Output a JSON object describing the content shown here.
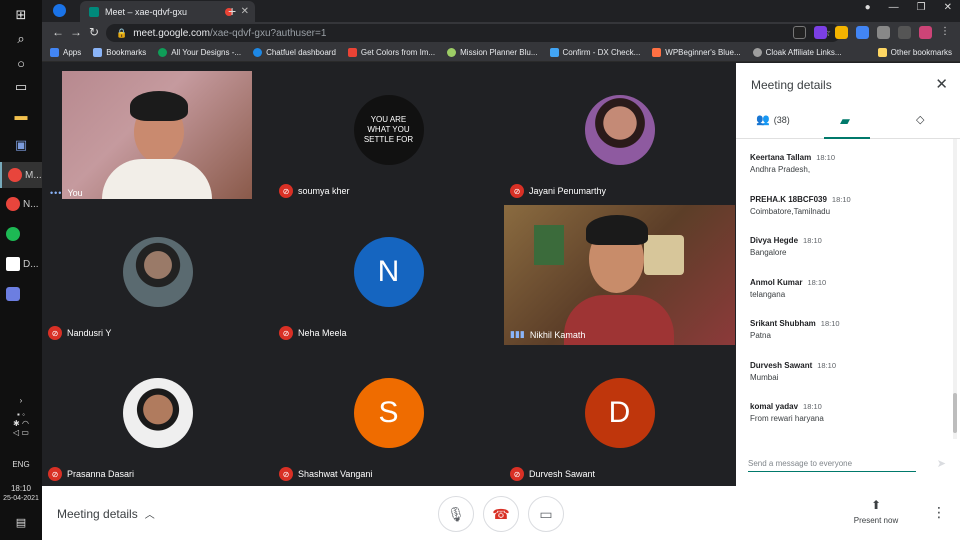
{
  "browser": {
    "tab_title": "Meet – xae-qdvf-gxu",
    "url_host": "meet.google.com",
    "url_path": "/xae-qdvf-gxu?authuser=1",
    "bookmarks": [
      "Apps",
      "Bookmarks",
      "All Your Designs -...",
      "Chatfuel dashboard",
      "Get Colors from Im...",
      "Mission Planner Blu...",
      "Confirm - DX Check...",
      "WPBeginner's Blue...",
      "Cloak Affiliate Links..."
    ],
    "other_bookmarks": "Other bookmarks"
  },
  "taskbar": {
    "apps": [
      "M...",
      "N...",
      "",
      "D...",
      ""
    ],
    "time": "18:10",
    "date": "25-04-2021",
    "lang": "ENG"
  },
  "participants": [
    {
      "name": "You",
      "type": "video-you",
      "muted": false
    },
    {
      "name": "soumya kher",
      "type": "quote",
      "muted": true,
      "quote": "YOU ARE WHAT YOU SETTLE FOR"
    },
    {
      "name": "Jayani Penumarthy",
      "type": "photo",
      "muted": true,
      "color": "#8e5aa0"
    },
    {
      "name": "Nandusri Y",
      "type": "photo",
      "muted": true,
      "color": "#6b6b6b"
    },
    {
      "name": "Neha Meela",
      "type": "letter",
      "muted": true,
      "letter": "N",
      "color": "#1565c0"
    },
    {
      "name": "Nikhil Kamath",
      "type": "video-nik",
      "muted": false
    },
    {
      "name": "Prasanna Dasari",
      "type": "photo",
      "muted": true,
      "color": "#efefef"
    },
    {
      "name": "Shashwat Vangani",
      "type": "letter",
      "muted": true,
      "letter": "S",
      "color": "#ef6c00"
    },
    {
      "name": "Durvesh Sawant",
      "type": "letter",
      "muted": true,
      "letter": "D",
      "color": "#bf360c"
    }
  ],
  "panel": {
    "title": "Meeting details",
    "people_count": "(38)",
    "messages": [
      {
        "sender": "Keertana Tallam",
        "time": "18:10",
        "text": "Andhra Pradesh,"
      },
      {
        "sender": "PREHA.K 18BCF039",
        "time": "18:10",
        "text": "Coimbatore,Tamilnadu"
      },
      {
        "sender": "Divya Hegde",
        "time": "18:10",
        "text": "Bangalore"
      },
      {
        "sender": "Anmol Kumar",
        "time": "18:10",
        "text": "telangana"
      },
      {
        "sender": "Srikant Shubham",
        "time": "18:10",
        "text": "Patna"
      },
      {
        "sender": "Durvesh Sawant",
        "time": "18:10",
        "text": "Mumbai"
      },
      {
        "sender": "komal yadav",
        "time": "18:10",
        "text": "From rewari haryana"
      }
    ],
    "compose_placeholder": "Send a message to everyone"
  },
  "bottombar": {
    "details_label": "Meeting details",
    "present_label": "Present now"
  },
  "colors": {
    "accent": "#00796b",
    "mute_red": "#d93025"
  }
}
